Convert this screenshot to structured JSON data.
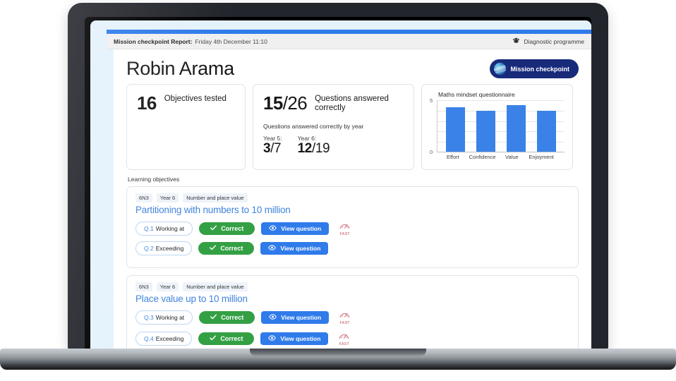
{
  "meta_bar": {
    "label": "Mission checkpoint Report:",
    "date": "Friday 4th December 11:10",
    "right_icon": "mortarboard-icon",
    "right_label": "Diagnostic programme"
  },
  "header": {
    "student_name": "Robin Arama",
    "badge": {
      "icon": "globe-icon",
      "label": "Mission checkpoint"
    }
  },
  "cards": {
    "objectives": {
      "value": "16",
      "label": "Objectives tested"
    },
    "questions": {
      "numerator": "15",
      "denominator": "/26",
      "label": "Questions answered correctly",
      "sub_label": "Questions answered correctly by year",
      "years": [
        {
          "label": "Year 5:",
          "numerator": "3",
          "denominator": "/7"
        },
        {
          "label": "Year 6:",
          "numerator": "12",
          "denominator": "/19"
        }
      ]
    }
  },
  "chart_data": {
    "type": "bar",
    "title": "Maths mindset questionnaire",
    "categories": [
      "Effort",
      "Confidence",
      "Value",
      "Enjoyment"
    ],
    "values": [
      4.3,
      4.0,
      4.5,
      4.0
    ],
    "xlabel": "",
    "ylabel": "",
    "ylim": [
      0,
      5
    ],
    "ytick_labels": [
      "5",
      "0"
    ],
    "grid": true,
    "legend": "none",
    "bar_color": "#3b82e8"
  },
  "learning_objectives": {
    "heading": "Learning objectives",
    "items": [
      {
        "tags": [
          "6N3",
          "Year 6",
          "Number and place value"
        ],
        "title": "Partitioning with numbers to 10 million",
        "questions": [
          {
            "q_number": "Q.1",
            "level": "Working at",
            "status": "Correct",
            "status_icon": "check-icon",
            "action": "View question",
            "action_icon": "eye-icon",
            "speed_icon": "speedometer-icon",
            "speed_label": "FAST"
          },
          {
            "q_number": "Q.2",
            "level": "Exceeding",
            "status": "Correct",
            "status_icon": "check-icon",
            "action": "View question",
            "action_icon": "eye-icon",
            "speed_icon": "",
            "speed_label": ""
          }
        ]
      },
      {
        "tags": [
          "6N3",
          "Year 6",
          "Number and place value"
        ],
        "title": "Place value up to 10 million",
        "questions": [
          {
            "q_number": "Q.3",
            "level": "Working at",
            "status": "Correct",
            "status_icon": "check-icon",
            "action": "View question",
            "action_icon": "eye-icon",
            "speed_icon": "speedometer-icon",
            "speed_label": "FAST"
          },
          {
            "q_number": "Q.4",
            "level": "Exceeding",
            "status": "Correct",
            "status_icon": "check-icon",
            "action": "View question",
            "action_icon": "eye-icon",
            "speed_icon": "speedometer-icon",
            "speed_label": "FAST"
          }
        ]
      }
    ]
  },
  "colors": {
    "accent_blue": "#2f7bea",
    "title_blue": "#3f84dd",
    "success_green": "#34a044",
    "badge_navy": "#182a7a",
    "page_bg": "#e4f2fc",
    "fast_red": "#d07b86"
  }
}
